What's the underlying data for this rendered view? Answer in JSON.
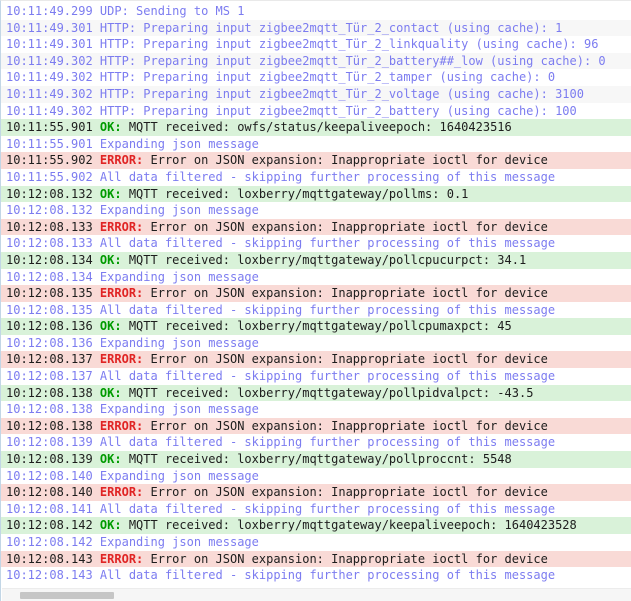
{
  "colors": {
    "info_text": "#7c7cf0",
    "ok_bg": "#d9f2d9",
    "ok_label": "#009b00",
    "error_bg": "#f9dad6",
    "error_label": "#e02424",
    "body_text": "#1d1d1d",
    "zebra_bg": "#f7f7f7",
    "border_left": "#c2d6e6",
    "scrollbar_track": "#f6f6f6",
    "scrollbar_thumb": "#c6c6c6"
  },
  "log": {
    "rows": [
      {
        "time": "10:11:49.299",
        "type": "info",
        "label": "",
        "text": "UDP: Sending to MS 1"
      },
      {
        "time": "10:11:49.301",
        "type": "info",
        "label": "",
        "text": "HTTP: Preparing input zigbee2mqtt_Tür_2_contact (using cache): 1"
      },
      {
        "time": "10:11:49.301",
        "type": "info",
        "label": "",
        "text": "HTTP: Preparing input zigbee2mqtt_Tür_2_linkquality (using cache): 96"
      },
      {
        "time": "10:11:49.302",
        "type": "info",
        "label": "",
        "text": "HTTP: Preparing input zigbee2mqtt_Tür_2_battery##_low (using cache): 0"
      },
      {
        "time": "10:11:49.302",
        "type": "info",
        "label": "",
        "text": "HTTP: Preparing input zigbee2mqtt_Tür_2_tamper (using cache): 0"
      },
      {
        "time": "10:11:49.302",
        "type": "info",
        "label": "",
        "text": "HTTP: Preparing input zigbee2mqtt_Tür_2_voltage (using cache): 3100"
      },
      {
        "time": "10:11:49.302",
        "type": "info",
        "label": "",
        "text": "HTTP: Preparing input zigbee2mqtt_Tür_2_battery (using cache): 100"
      },
      {
        "time": "10:11:55.901",
        "type": "ok",
        "label": "OK:",
        "text": "MQTT received: owfs/status/keepaliveepoch: 1640423516"
      },
      {
        "time": "10:11:55.901",
        "type": "info",
        "label": "",
        "text": "Expanding json message"
      },
      {
        "time": "10:11:55.902",
        "type": "error",
        "label": "ERROR:",
        "text": "Error on JSON expansion: Inappropriate ioctl for device"
      },
      {
        "time": "10:11:55.902",
        "type": "info",
        "label": "",
        "text": "All data filtered - skipping further processing of this message"
      },
      {
        "time": "10:12:08.132",
        "type": "ok",
        "label": "OK:",
        "text": "MQTT received: loxberry/mqttgateway/pollms: 0.1"
      },
      {
        "time": "10:12:08.132",
        "type": "info",
        "label": "",
        "text": "Expanding json message"
      },
      {
        "time": "10:12:08.133",
        "type": "error",
        "label": "ERROR:",
        "text": "Error on JSON expansion: Inappropriate ioctl for device"
      },
      {
        "time": "10:12:08.133",
        "type": "info",
        "label": "",
        "text": "All data filtered - skipping further processing of this message"
      },
      {
        "time": "10:12:08.134",
        "type": "ok",
        "label": "OK:",
        "text": "MQTT received: loxberry/mqttgateway/pollcpucurpct: 34.1"
      },
      {
        "time": "10:12:08.134",
        "type": "info",
        "label": "",
        "text": "Expanding json message"
      },
      {
        "time": "10:12:08.135",
        "type": "error",
        "label": "ERROR:",
        "text": "Error on JSON expansion: Inappropriate ioctl for device"
      },
      {
        "time": "10:12:08.135",
        "type": "info",
        "label": "",
        "text": "All data filtered - skipping further processing of this message"
      },
      {
        "time": "10:12:08.136",
        "type": "ok",
        "label": "OK:",
        "text": "MQTT received: loxberry/mqttgateway/pollcpumaxpct: 45"
      },
      {
        "time": "10:12:08.136",
        "type": "info",
        "label": "",
        "text": "Expanding json message"
      },
      {
        "time": "10:12:08.137",
        "type": "error",
        "label": "ERROR:",
        "text": "Error on JSON expansion: Inappropriate ioctl for device"
      },
      {
        "time": "10:12:08.137",
        "type": "info",
        "label": "",
        "text": "All data filtered - skipping further processing of this message"
      },
      {
        "time": "10:12:08.138",
        "type": "ok",
        "label": "OK:",
        "text": "MQTT received: loxberry/mqttgateway/pollpidvalpct: -43.5"
      },
      {
        "time": "10:12:08.138",
        "type": "info",
        "label": "",
        "text": "Expanding json message"
      },
      {
        "time": "10:12:08.138",
        "type": "error",
        "label": "ERROR:",
        "text": "Error on JSON expansion: Inappropriate ioctl for device"
      },
      {
        "time": "10:12:08.139",
        "type": "info",
        "label": "",
        "text": "All data filtered - skipping further processing of this message"
      },
      {
        "time": "10:12:08.139",
        "type": "ok",
        "label": "OK:",
        "text": "MQTT received: loxberry/mqttgateway/pollproccnt: 5548"
      },
      {
        "time": "10:12:08.140",
        "type": "info",
        "label": "",
        "text": "Expanding json message"
      },
      {
        "time": "10:12:08.140",
        "type": "error",
        "label": "ERROR:",
        "text": "Error on JSON expansion: Inappropriate ioctl for device"
      },
      {
        "time": "10:12:08.141",
        "type": "info",
        "label": "",
        "text": "All data filtered - skipping further processing of this message"
      },
      {
        "time": "10:12:08.142",
        "type": "ok",
        "label": "OK:",
        "text": "MQTT received: loxberry/mqttgateway/keepaliveepoch: 1640423528"
      },
      {
        "time": "10:12:08.142",
        "type": "info",
        "label": "",
        "text": "Expanding json message"
      },
      {
        "time": "10:12:08.143",
        "type": "error",
        "label": "ERROR:",
        "text": "Error on JSON expansion: Inappropriate ioctl for device"
      },
      {
        "time": "10:12:08.143",
        "type": "info",
        "label": "",
        "text": "All data filtered - skipping further processing of this message"
      }
    ]
  }
}
